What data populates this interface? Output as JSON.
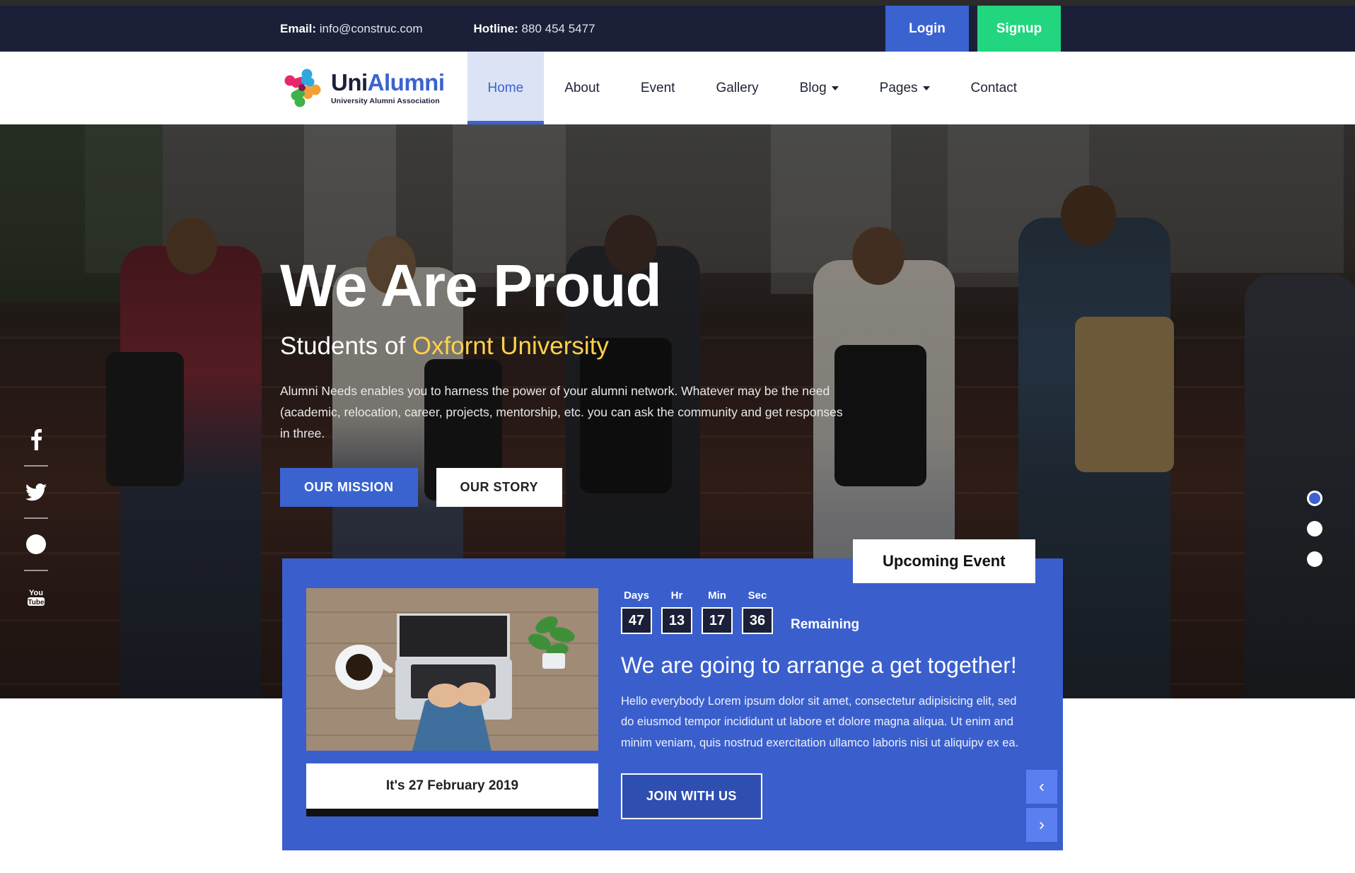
{
  "topbar": {
    "email_label": "Email:",
    "email_value": "info@construc.com",
    "hotline_label": "Hotline:",
    "hotline_value": "880 454 5477",
    "login_label": "Login",
    "signup_label": "Signup",
    "login_color": "#3a63d0",
    "signup_color": "#22d67f",
    "background": "#1b2038"
  },
  "logo": {
    "name_first": "Uni",
    "name_second": "Alumni",
    "tagline": "University Alumni Association",
    "first_color": "#1b2038",
    "second_color": "#3a63d0"
  },
  "nav": {
    "items": [
      {
        "label": "Home",
        "active": true,
        "has_dropdown": false
      },
      {
        "label": "About",
        "active": false,
        "has_dropdown": false
      },
      {
        "label": "Event",
        "active": false,
        "has_dropdown": false
      },
      {
        "label": "Gallery",
        "active": false,
        "has_dropdown": false
      },
      {
        "label": "Blog",
        "active": false,
        "has_dropdown": true
      },
      {
        "label": "Pages",
        "active": false,
        "has_dropdown": true
      },
      {
        "label": "Contact",
        "active": false,
        "has_dropdown": false
      }
    ],
    "active_color": "#3a63d0",
    "active_bg": "#dbe3f5"
  },
  "hero": {
    "title": "We Are Proud",
    "subtitle_prefix": "Students of ",
    "subtitle_highlight": "Oxfornt University",
    "highlight_color": "#ffd24a",
    "description": "Alumni Needs enables you to harness the power of your alumni network. Whatever may be the need (academic, relocation, career, projects, mentorship, etc. you can ask the community and get responses in three.",
    "primary_button": "OUR MISSION",
    "secondary_button": "OUR STORY",
    "slider_dots": 3,
    "active_dot": 1
  },
  "social": {
    "items": [
      {
        "name": "facebook-icon"
      },
      {
        "name": "twitter-icon"
      },
      {
        "name": "pinterest-icon"
      },
      {
        "name": "youtube-icon"
      }
    ]
  },
  "event": {
    "badge": "Upcoming Event",
    "caption": "It's 27 February 2019",
    "countdown": [
      {
        "label": "Days",
        "value": "47"
      },
      {
        "label": "Hr",
        "value": "13"
      },
      {
        "label": "Min",
        "value": "17"
      },
      {
        "label": "Sec",
        "value": "36"
      }
    ],
    "remaining_label": "Remaining",
    "title": "We are going to arrange a get together!",
    "text": "Hello everybody Lorem ipsum dolor sit amet, consectetur adipisicing elit, sed do eiusmod tempor incididunt ut labore et dolore magna aliqua. Ut enim and minim veniam, quis nostrud exercitation ullamco laboris nisi ut aliquipv ex ea.",
    "join_button": "JOIN WITH US",
    "prev_label": "‹",
    "next_label": "›",
    "card_color": "#3a5fcd"
  }
}
